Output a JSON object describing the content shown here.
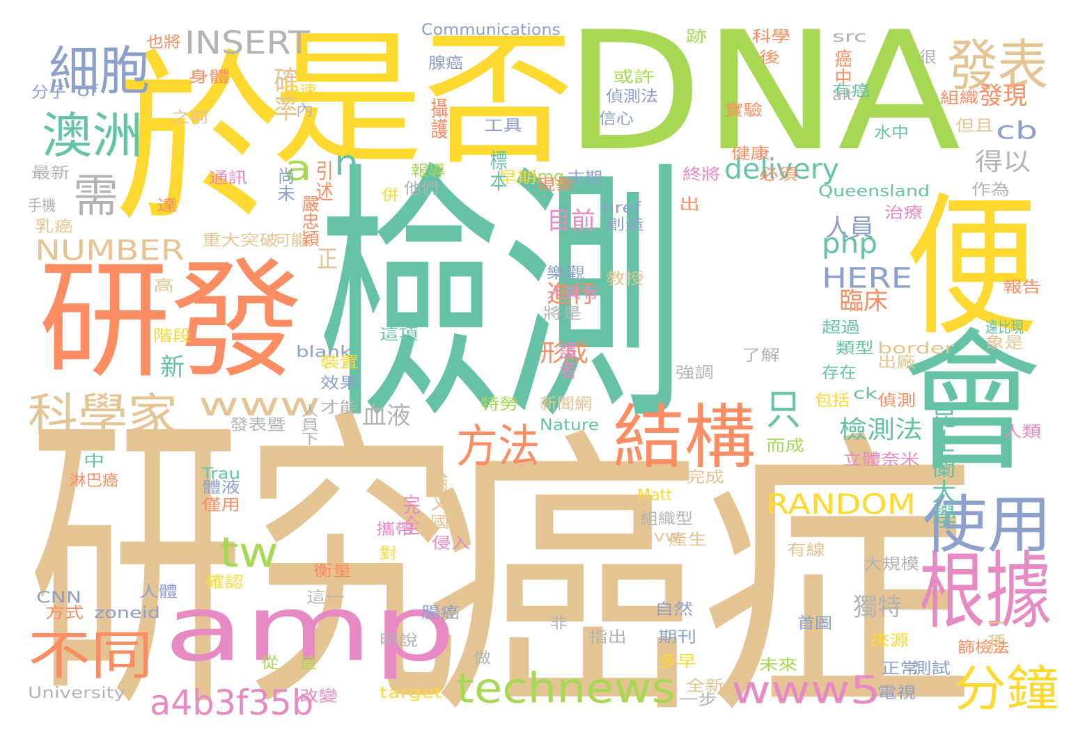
{
  "colors": {
    "background": "#ffffff",
    "palette": [
      "#66c2a5",
      "#fc8d62",
      "#8da0cb",
      "#e78ac3",
      "#a6d854",
      "#ffd92f",
      "#e5c494",
      "#b3b3b3"
    ]
  },
  "words": [
    {
      "text": "檢測",
      "color": "#66c2a5"
    },
    {
      "text": "癌症",
      "color": "#e5c494"
    },
    {
      "text": "研究",
      "color": "#e5c494"
    },
    {
      "text": "DNA",
      "color": "#a6d854"
    },
    {
      "text": "於",
      "color": "#ffd92f"
    },
    {
      "text": "是否",
      "color": "#ffd92f"
    },
    {
      "text": "研發",
      "color": "#fc8d62"
    },
    {
      "text": "amp",
      "color": "#e78ac3"
    },
    {
      "text": "便",
      "color": "#ffd92f"
    },
    {
      "text": "會",
      "color": "#66c2a5"
    },
    {
      "text": "結構",
      "color": "#fc8d62"
    },
    {
      "text": "根據",
      "color": "#e78ac3"
    },
    {
      "text": "使用",
      "color": "#8da0cb"
    },
    {
      "text": "發表",
      "color": "#e5c494"
    },
    {
      "text": "細胞",
      "color": "#8da0cb"
    },
    {
      "text": "澳洲",
      "color": "#66c2a5"
    },
    {
      "text": "科學家",
      "color": "#e5c494"
    },
    {
      "text": "不同",
      "color": "#fc8d62"
    },
    {
      "text": "technews",
      "color": "#a6d854"
    },
    {
      "text": "www5",
      "color": "#e78ac3"
    },
    {
      "text": "a4b3f35b",
      "color": "#e78ac3"
    },
    {
      "text": "分鐘",
      "color": "#ffd92f"
    },
    {
      "text": "www",
      "color": "#e5c494"
    },
    {
      "text": "方法",
      "color": "#fc8d62"
    },
    {
      "text": "tw",
      "color": "#a6d854"
    },
    {
      "text": "INSERT",
      "color": "#b3b3b3"
    },
    {
      "text": "需",
      "color": "#b3b3b3"
    },
    {
      "text": "a",
      "color": "#a6d854"
    },
    {
      "text": "n",
      "color": "#66c2a5"
    },
    {
      "text": "NUMBER",
      "color": "#e5c494"
    },
    {
      "text": "RANDOM",
      "color": "#ffd92f"
    },
    {
      "text": "delivery",
      "color": "#66c2a5"
    },
    {
      "text": "php",
      "color": "#66c2a5"
    },
    {
      "text": "HERE",
      "color": "#8da0cb"
    },
    {
      "text": "cb",
      "color": "#8da0cb"
    },
    {
      "text": "只",
      "color": "#66c2a5"
    },
    {
      "text": "昆士蘭大學",
      "color": "#66c2a5"
    },
    {
      "text": "得以",
      "color": "#b3b3b3"
    },
    {
      "text": "發現",
      "color": "#fc8d62"
    },
    {
      "text": "檢測法",
      "color": "#66c2a5"
    },
    {
      "text": "目前",
      "color": "#e78ac3"
    },
    {
      "text": "人員",
      "color": "#8da0cb"
    },
    {
      "text": "臨床",
      "color": "#fc8d62"
    },
    {
      "text": "進行",
      "color": "#fc8d62"
    },
    {
      "text": "確率",
      "color": "#e5c494"
    },
    {
      "text": "形成",
      "color": "#fc8d62"
    },
    {
      "text": "血液",
      "color": "#b3b3b3"
    },
    {
      "text": "獨特",
      "color": "#b3b3b3"
    },
    {
      "text": "正",
      "color": "#e5c494"
    },
    {
      "text": "新",
      "color": "#66c2a5"
    },
    {
      "text": "Communications",
      "color": "#8da0cb"
    },
    {
      "text": "也將",
      "color": "#fc8d62"
    },
    {
      "text": "身體",
      "color": "#fc8d62"
    },
    {
      "text": "分子",
      "color": "#8da0cb"
    },
    {
      "text": "of",
      "color": "#8da0cb"
    },
    {
      "text": "快速",
      "color": "#ffd92f"
    },
    {
      "text": "內",
      "color": "#b3b3b3"
    },
    {
      "text": "之前",
      "color": "#e5c494"
    },
    {
      "text": "最新",
      "color": "#b3b3b3"
    },
    {
      "text": "通訊",
      "color": "#e78ac3"
    },
    {
      "text": "手機",
      "color": "#b3b3b3"
    },
    {
      "text": "達",
      "color": "#fc8d62"
    },
    {
      "text": "乳癌",
      "color": "#e5c494"
    },
    {
      "text": "重大突破",
      "color": "#e5c494"
    },
    {
      "text": "可能",
      "color": "#e5c494"
    },
    {
      "text": "嚴忠穎",
      "color": "#fc8d62"
    },
    {
      "text": "引述",
      "color": "#fc8d62"
    },
    {
      "text": "尚未",
      "color": "#8da0cb"
    },
    {
      "text": "併",
      "color": "#ffd92f"
    },
    {
      "text": "他們",
      "color": "#b3b3b3"
    },
    {
      "text": "報導",
      "color": "#a6d854"
    },
    {
      "text": "早期",
      "color": "#ffd92f"
    },
    {
      "text": "img",
      "color": "#a6d854"
    },
    {
      "text": "標本",
      "color": "#66c2a5"
    },
    {
      "text": "末期",
      "color": "#8da0cb"
    },
    {
      "text": "現象",
      "color": "#fc8d62"
    },
    {
      "text": "腺癌",
      "color": "#8da0cb"
    },
    {
      "text": "攝護",
      "color": "#fc8d62"
    },
    {
      "text": "工具",
      "color": "#8da0cb"
    },
    {
      "text": "或許",
      "color": "#a6d854"
    },
    {
      "text": "偵測法",
      "color": "#8da0cb"
    },
    {
      "text": "信心",
      "color": "#8da0cb"
    },
    {
      "text": "跡",
      "color": "#a6d854"
    },
    {
      "text": "科學",
      "color": "#fc8d62"
    },
    {
      "text": "後",
      "color": "#fc8d62"
    },
    {
      "text": "src",
      "color": "#b3b3b3"
    },
    {
      "text": "癌中",
      "color": "#fc8d62"
    },
    {
      "text": "很",
      "color": "#b3b3b3"
    },
    {
      "text": "有癌",
      "color": "#66c2a5"
    },
    {
      "text": "alt",
      "color": "#b3b3b3"
    },
    {
      "text": "組織",
      "color": "#fc8d62"
    },
    {
      "text": "實驗",
      "color": "#fc8d62"
    },
    {
      "text": "水中",
      "color": "#66c2a5"
    },
    {
      "text": "但且",
      "color": "#e5c494"
    },
    {
      "text": "健康",
      "color": "#fc8d62"
    },
    {
      "text": "終將",
      "color": "#e78ac3"
    },
    {
      "text": "必須",
      "color": "#fc8d62"
    },
    {
      "text": "Queensland",
      "color": "#66c2a5"
    },
    {
      "text": "作為",
      "color": "#b3b3b3"
    },
    {
      "text": "出",
      "color": "#fc8d62"
    },
    {
      "text": "href",
      "color": "#8da0cb"
    },
    {
      "text": "創造",
      "color": "#8da0cb"
    },
    {
      "text": "治療",
      "color": "#e78ac3"
    },
    {
      "text": "樂觀",
      "color": "#8da0cb"
    },
    {
      "text": "人員有",
      "color": "#e78ac3"
    },
    {
      "text": "教授",
      "color": "#e5c494"
    },
    {
      "text": "報告",
      "color": "#fc8d62"
    },
    {
      "text": "將是",
      "color": "#b3b3b3"
    },
    {
      "text": "高",
      "color": "#e5c494"
    },
    {
      "text": "階段",
      "color": "#ffd92f"
    },
    {
      "text": "這項",
      "color": "#66c2a5"
    },
    {
      "text": "blank",
      "color": "#8da0cb"
    },
    {
      "text": "遠比現",
      "color": "#66c2a5"
    },
    {
      "text": "象是",
      "color": "#e5c494"
    },
    {
      "text": "譯者",
      "color": "#e78ac3"
    },
    {
      "text": "了解",
      "color": "#b3b3b3"
    },
    {
      "text": "超過",
      "color": "#66c2a5"
    },
    {
      "text": "類型",
      "color": "#66c2a5"
    },
    {
      "text": "border",
      "color": "#e5c494"
    },
    {
      "text": "出廠",
      "color": "#e5c494"
    },
    {
      "text": "裝置",
      "color": "#ffd92f"
    },
    {
      "text": "效果",
      "color": "#8da0cb"
    },
    {
      "text": "強調",
      "color": "#b3b3b3"
    },
    {
      "text": "存在",
      "color": "#66c2a5"
    },
    {
      "text": "人員下",
      "color": "#b3b3b3"
    },
    {
      "text": "才能",
      "color": "#b3b3b3"
    },
    {
      "text": "特勞",
      "color": "#a6d854"
    },
    {
      "text": "新聞網",
      "color": "#e5c494"
    },
    {
      "text": "包括",
      "color": "#ffd92f"
    },
    {
      "text": "ck",
      "color": "#66c2a5"
    },
    {
      "text": "偵測",
      "color": "#fc8d62"
    },
    {
      "text": "發表暨",
      "color": "#b3b3b3"
    },
    {
      "text": "Nature",
      "color": "#66c2a5"
    },
    {
      "text": "而成",
      "color": "#a6d854"
    },
    {
      "text": "人類",
      "color": "#e78ac3"
    },
    {
      "text": "中",
      "color": "#66c2a5"
    },
    {
      "text": "Trau",
      "color": "#66c2a5"
    },
    {
      "text": "淋巴癌",
      "color": "#fc8d62"
    },
    {
      "text": "論文",
      "color": "#e5c494"
    },
    {
      "text": "立體奈米",
      "color": "#e78ac3"
    },
    {
      "text": "體液",
      "color": "#8da0cb"
    },
    {
      "text": "完成",
      "color": "#e5c494"
    },
    {
      "text": "僅用",
      "color": "#fc8d62"
    },
    {
      "text": "Matt",
      "color": "#ffd92f"
    },
    {
      "text": "完全",
      "color": "#e78ac3"
    },
    {
      "text": "美國",
      "color": "#e5c494"
    },
    {
      "text": "組織型",
      "color": "#b3b3b3"
    },
    {
      "text": "攜帶",
      "color": "#e78ac3"
    },
    {
      "text": "侵入",
      "color": "#e78ac3"
    },
    {
      "text": "avw",
      "color": "#e5c494"
    },
    {
      "text": "產生",
      "color": "#e5c494"
    },
    {
      "text": "有線",
      "color": "#e5c494"
    },
    {
      "text": "對",
      "color": "#ffd92f"
    },
    {
      "text": "大規模",
      "color": "#b3b3b3"
    },
    {
      "text": "衡量",
      "color": "#fc8d62"
    },
    {
      "text": "確認",
      "color": "#ffd92f"
    },
    {
      "text": "人體",
      "color": "#8da0cb"
    },
    {
      "text": "這一",
      "color": "#b3b3b3"
    },
    {
      "text": "CNN",
      "color": "#8da0cb"
    },
    {
      "text": "zoneid",
      "color": "#8da0cb"
    },
    {
      "text": "方式",
      "color": "#fc8d62"
    },
    {
      "text": "腸癌",
      "color": "#8da0cb"
    },
    {
      "text": "自然",
      "color": "#8da0cb"
    },
    {
      "text": "非",
      "color": "#b3b3b3"
    },
    {
      "text": "指出",
      "color": "#b3b3b3"
    },
    {
      "text": "首圖",
      "color": "#8da0cb"
    },
    {
      "text": "期刊",
      "color": "#8da0cb"
    },
    {
      "text": "明說",
      "color": "#b3b3b3"
    },
    {
      "text": "來源",
      "color": "#ffd92f"
    },
    {
      "text": "一種",
      "color": "#e5c494"
    },
    {
      "text": "篩檢法",
      "color": "#fc8d62"
    },
    {
      "text": "做",
      "color": "#b3b3b3"
    },
    {
      "text": "從",
      "color": "#a6d854"
    },
    {
      "text": "這",
      "color": "#a6d854"
    },
    {
      "text": "多早",
      "color": "#ffd92f"
    },
    {
      "text": "正常",
      "color": "#8da0cb"
    },
    {
      "text": "測試",
      "color": "#8da0cb"
    },
    {
      "text": "未來",
      "color": "#a6d854"
    },
    {
      "text": "全新",
      "color": "#e5c494"
    },
    {
      "text": "電視",
      "color": "#8da0cb"
    },
    {
      "text": "University",
      "color": "#b3b3b3"
    },
    {
      "text": "改變",
      "color": "#e78ac3"
    },
    {
      "text": "target",
      "color": "#ffd92f"
    },
    {
      "text": "一步",
      "color": "#b3b3b3"
    }
  ]
}
